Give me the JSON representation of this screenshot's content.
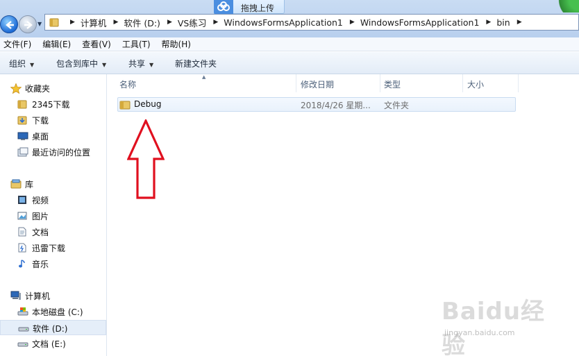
{
  "address": {
    "breadcrumbs": [
      "计算机",
      "软件 (D:)",
      "VS练习",
      "WindowsFormsApplication1",
      "WindowsFormsApplication1",
      "bin"
    ]
  },
  "upload_tab": {
    "label": "拖拽上传"
  },
  "menu": [
    "文件(F)",
    "编辑(E)",
    "查看(V)",
    "工具(T)",
    "帮助(H)"
  ],
  "toolbar": {
    "organize": "组织",
    "include_library": "包含到库中",
    "share": "共享",
    "new_folder": "新建文件夹"
  },
  "nav": {
    "favorites": {
      "label": "收藏夹",
      "items": [
        "2345下载",
        "下载",
        "桌面",
        "最近访问的位置"
      ]
    },
    "libraries": {
      "label": "库",
      "items": [
        "视频",
        "图片",
        "文档",
        "迅雷下载",
        "音乐"
      ]
    },
    "computer": {
      "label": "计算机",
      "items": [
        "本地磁盘 (C:)",
        "软件 (D:)",
        "文档 (E:)"
      ],
      "selected": "软件 (D:)"
    }
  },
  "columns": [
    "名称",
    "修改日期",
    "类型",
    "大小"
  ],
  "files": [
    {
      "name": "Debug",
      "modified": "2018/4/26 星期...",
      "type": "文件夹",
      "size": ""
    }
  ],
  "watermark": {
    "main": "Baidu经验",
    "sub": "jingyan.baidu.com"
  },
  "colors": {
    "annotation_arrow": "#e0101f",
    "selection": "#e5eef9"
  }
}
